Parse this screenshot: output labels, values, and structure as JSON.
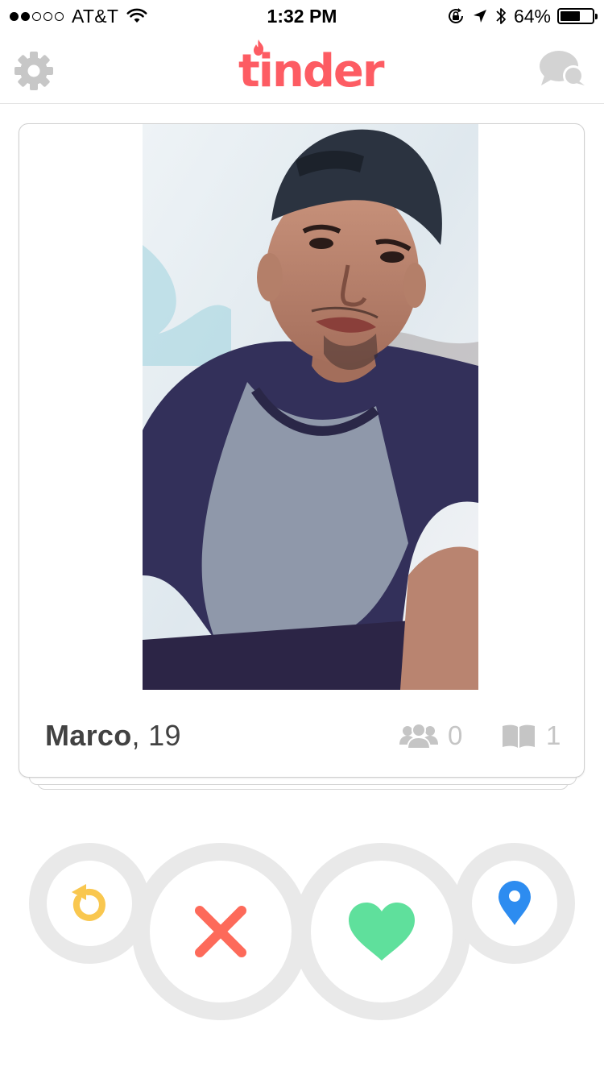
{
  "status_bar": {
    "signal_bars": 5,
    "signal_filled": 2,
    "carrier": "AT&T",
    "time": "1:32 PM",
    "battery_percent": "64%",
    "battery_level": 0.64
  },
  "nav": {
    "logo_text": "tinder",
    "left_icon": "gear-icon",
    "right_icon": "chat-bubbles-icon"
  },
  "profile": {
    "name": "Marco",
    "age": "19",
    "friends_count": "0",
    "interests_count": "1",
    "photo_description_icon": "profile-photo"
  },
  "actions": {
    "rewind_icon": "rewind-icon",
    "nope_icon": "x-icon",
    "like_icon": "heart-icon",
    "boost_icon": "location-pin-icon"
  },
  "colors": {
    "brand": "#fd5c63",
    "rewind": "#f9c74f",
    "nope": "#fd6a5a",
    "like": "#5fe09c",
    "boost": "#2d8cf0",
    "button_ring": "#e9e9e9",
    "stat_grey": "#c5c5c5"
  }
}
